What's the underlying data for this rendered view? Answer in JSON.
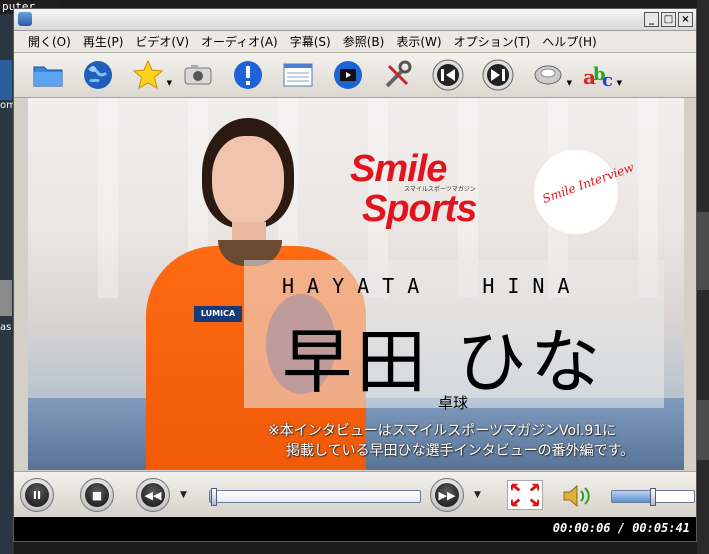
{
  "desktop": {
    "top_text": "puter",
    "left_label_a": "om",
    "left_label_b": "as"
  },
  "window": {
    "controls": [
      "_",
      "□",
      "×"
    ]
  },
  "menu": [
    "開く(O)",
    "再生(P)",
    "ビデオ(V)",
    "オーディオ(A)",
    "字幕(S)",
    "参照(B)",
    "表示(W)",
    "オプション(T)",
    "ヘルプ(H)"
  ],
  "toolbar": {
    "icons": [
      "folder-icon",
      "globe-icon",
      "star-icon",
      "camera-icon",
      "info-icon",
      "playlist-icon",
      "video-settings-icon",
      "tools-icon",
      "previous-icon",
      "next-icon",
      "audio-disc-icon",
      "subtitle-abc-icon"
    ]
  },
  "video": {
    "logo_line1": "Smile",
    "logo_line2": "Sports",
    "logo_sub": "スマイルスポーツマガジン",
    "badge_text": "Smile Interview",
    "latin_name": "HAYATA  HINA",
    "kanji_name": "早田 ひな",
    "sport": "卓球",
    "caption_line1": "※本インタビューはスマイルスポーツマガジンVol.91に",
    "caption_line2": "掲載している早田ひな選手インタビューの番外編です。",
    "patch_text": "LUMICA"
  },
  "controls": {
    "pause_label": "II",
    "stop_label": "■",
    "rewind_label": "◀◀",
    "forward_label": "▶▶",
    "seek_progress": 0.018,
    "volume_level": 0.5
  },
  "status": {
    "time": "00:00:06 / 00:05:41"
  },
  "colors": {
    "logo_red": "#e1141d",
    "shirt_orange": "#f05a08"
  }
}
